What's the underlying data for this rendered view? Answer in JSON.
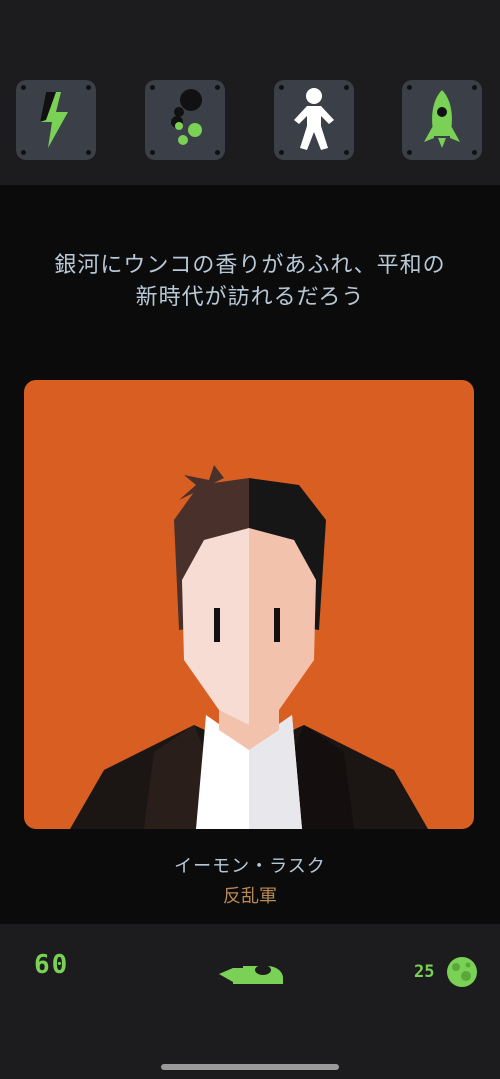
{
  "stats": [
    {
      "name": "energy",
      "icon": "lightning-icon"
    },
    {
      "name": "poop",
      "icon": "poop-balls-icon"
    },
    {
      "name": "people",
      "icon": "person-icon"
    },
    {
      "name": "rocket",
      "icon": "rocket-icon"
    }
  ],
  "message": {
    "line1": "銀河にウンコの香りがあふれ、平和の",
    "line2": "新時代が訪れるだろう"
  },
  "character": {
    "name": "イーモン・ラスク",
    "faction": "反乱軍",
    "portrait_icon": "portrait-man-in-suit"
  },
  "bottom": {
    "left_count": "60",
    "right_count": "25",
    "center_icon": "spaceship-icon",
    "right_icon": "planet-icon"
  },
  "colors": {
    "accent_green": "#7bd155",
    "card_orange": "#d85f21",
    "text_blue": "#b8c8d6",
    "faction_gold": "#b98a55"
  }
}
